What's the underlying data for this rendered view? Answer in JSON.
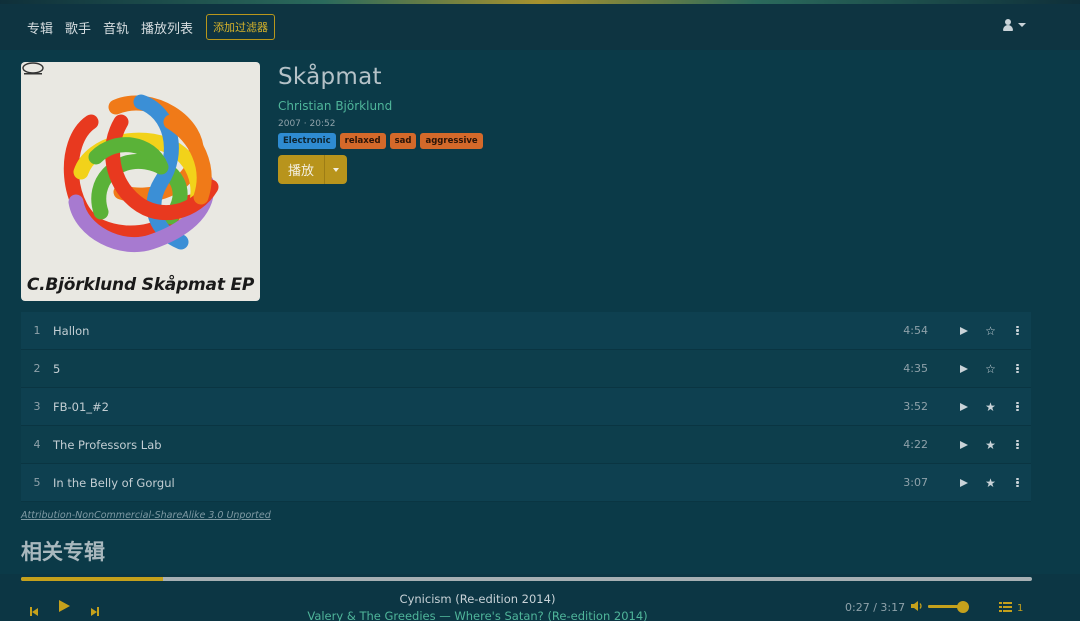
{
  "nav": {
    "links": [
      "专辑",
      "歌手",
      "音轨",
      "播放列表"
    ],
    "filter_button": "添加过滤器"
  },
  "album": {
    "title": "Skåpmat",
    "artist": "Christian Björklund",
    "meta": "2007 · 20:52",
    "tags": [
      {
        "label": "Electronic",
        "color": "#2e8bd1"
      },
      {
        "label": "relaxed",
        "color": "#d4692a"
      },
      {
        "label": "sad",
        "color": "#d4692a"
      },
      {
        "label": "aggressive",
        "color": "#d4692a"
      }
    ],
    "play_label": "播放",
    "cover_text": "C.Björklund  Skåpmat EP"
  },
  "tracks": [
    {
      "num": "1",
      "title": "Hallon",
      "duration": "4:54",
      "starred": false
    },
    {
      "num": "2",
      "title": "5",
      "duration": "4:35",
      "starred": false
    },
    {
      "num": "3",
      "title": "FB-01_#2",
      "duration": "3:52",
      "starred": true
    },
    {
      "num": "4",
      "title": "The Professors Lab",
      "duration": "4:22",
      "starred": true
    },
    {
      "num": "5",
      "title": "In the Belly of Gorgul",
      "duration": "3:07",
      "starred": true
    }
  ],
  "license": "Attribution-NonCommercial-ShareAlike 3.0 Unported",
  "related_title": "相关专辑",
  "player": {
    "now_title": "Cynicism (Re-edition 2014)",
    "now_sub": "Valery & The Greedies — Where's Satan? (Re-edition 2014)",
    "time": "0:27 / 3:17",
    "progress": 0.14,
    "volume": 0.82,
    "queue_count": "1"
  },
  "colors": {
    "background": "#0b3a48",
    "accent": "#c5a11c",
    "link": "#4fb59a"
  }
}
